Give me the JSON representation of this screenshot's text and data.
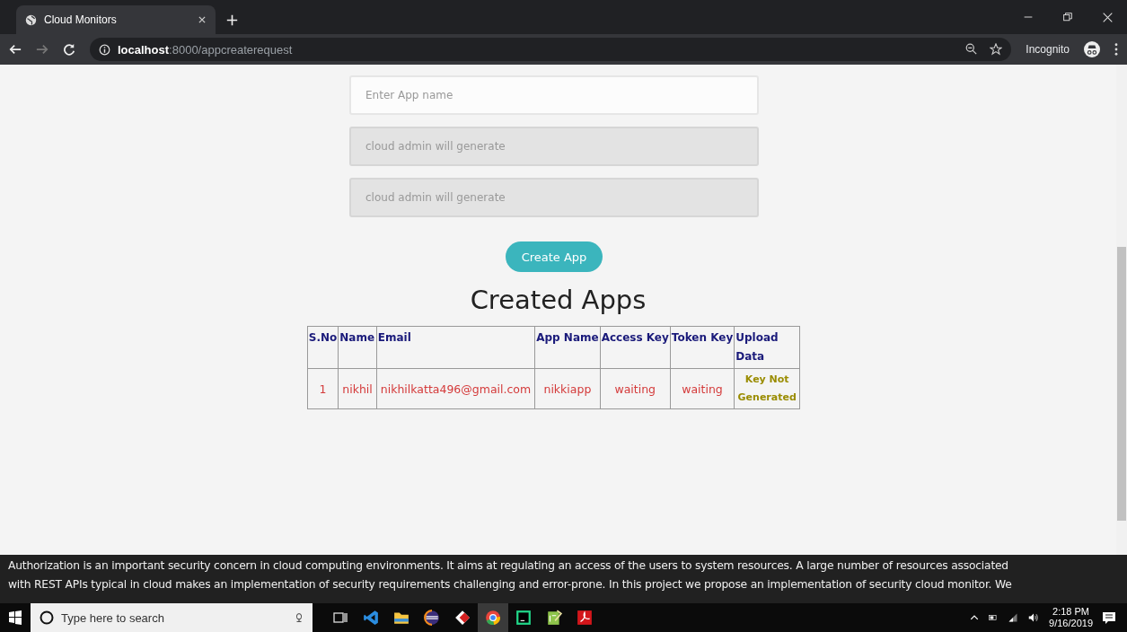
{
  "browser": {
    "tab_title": "Cloud Monitors",
    "url_host": "localhost",
    "url_path": ":8000/appcreaterequest",
    "incognito_label": "Incognito"
  },
  "form": {
    "fields": [
      {
        "placeholder": "Enter App name",
        "disabled": false
      },
      {
        "placeholder": "cloud admin will generate",
        "disabled": true
      },
      {
        "placeholder": "cloud admin will generate",
        "disabled": true
      }
    ],
    "button": "Create App"
  },
  "heading": "Created Apps",
  "table": {
    "columns": [
      "S.No",
      "Name",
      "Email",
      "App Name",
      "Access Key",
      "Token Key",
      "Upload Data"
    ],
    "rows": [
      {
        "cells": [
          "1",
          "nikhil",
          "nikhilkatta496@gmail.com",
          "nikkiapp",
          "waiting",
          "waiting"
        ],
        "upload": "Key Not Generated"
      }
    ]
  },
  "footer": {
    "lines": [
      "Authorization is an important security concern in cloud computing environments. It aims at regulating an access of the users to system resources. A large number of resources associated",
      "with REST APIs typical in cloud makes an implementation of security requirements challenging and error-prone. In this project we propose an implementation of security cloud monitor. We"
    ]
  },
  "taskbar": {
    "search_placeholder": "Type here to search",
    "time": "2:18 PM",
    "date": "9/16/2019"
  }
}
